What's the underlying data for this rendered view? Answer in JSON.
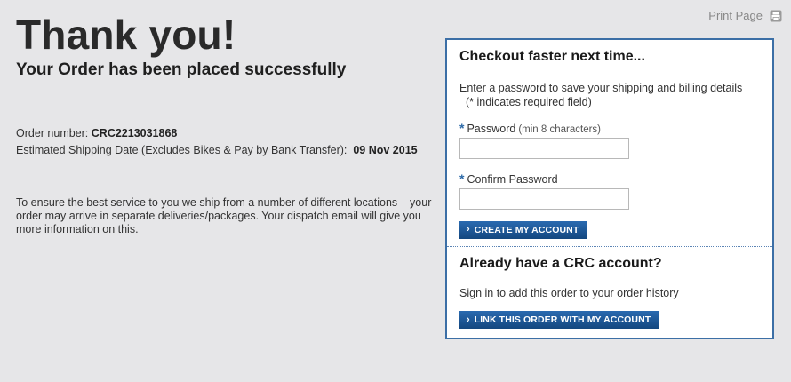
{
  "header": {
    "print_label": "Print Page"
  },
  "confirmation": {
    "title": "Thank you!",
    "subtitle": "Your Order has been placed successfully",
    "order_number_label": "Order number: ",
    "order_number": "CRC2213031868",
    "shipping_label": "Estimated Shipping Date (Excludes Bikes & Pay by Bank Transfer):  ",
    "shipping_date": "09 Nov 2015",
    "note": "To ensure the best service to you we ship from a number of different locations – your order may arrive in separate deliveries/packages. Your dispatch email will give you more information on this."
  },
  "checkout_panel": {
    "heading": "Checkout faster next time...",
    "intro": "Enter a password to save your shipping and billing details",
    "required_note": "(* indicates required field)",
    "required_marker": "*",
    "password_label": "Password",
    "password_hint": "(min 8 characters)",
    "password_value": "",
    "confirm_label": "Confirm Password",
    "confirm_value": "",
    "create_button": "CREATE MY ACCOUNT"
  },
  "account_panel": {
    "heading": "Already have a CRC account?",
    "text": "Sign in to add this order to your order history",
    "link_button": "LINK THIS ORDER WITH MY ACCOUNT"
  },
  "colors": {
    "panel_border": "#3c6fa6",
    "button_bg": "#1f5a99",
    "required_star": "#2d6aa8",
    "page_bg": "#e6e6e8"
  },
  "icons": {
    "print": "printer-icon",
    "chevron": "chevron-right-icon"
  }
}
